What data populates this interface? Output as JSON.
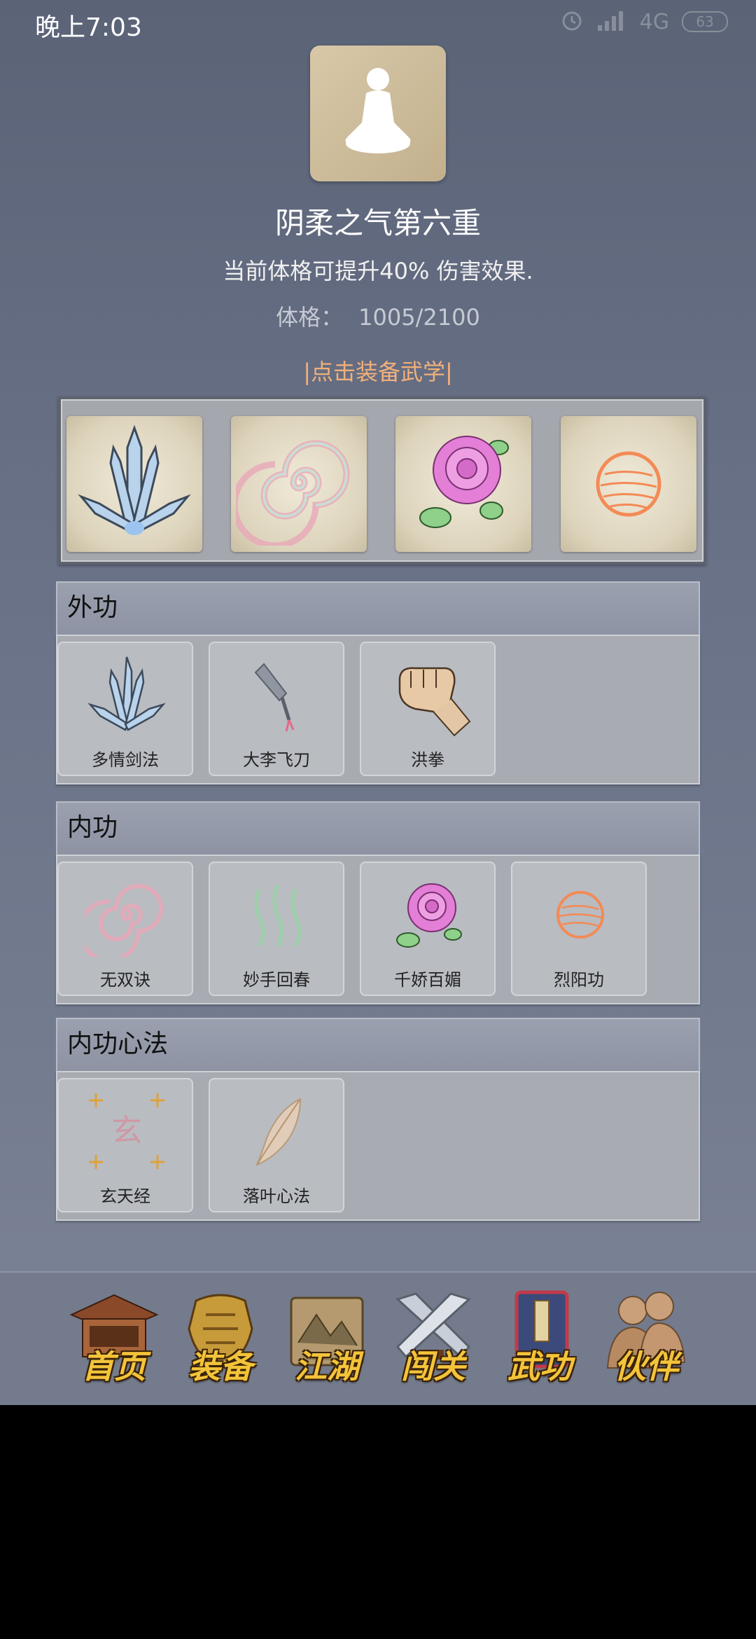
{
  "status_bar": {
    "time": "晚上7:03",
    "network": "4G",
    "battery": "63"
  },
  "header": {
    "title": "阴柔之气第六重",
    "description": "当前体格可提升40% 伤害效果.",
    "stat_label": "体格：",
    "stat_value": "1005/2100",
    "equip_hint": "|点击装备武学|"
  },
  "equipped_slots": [
    "sword-skill-icon",
    "swirl-skill-icon",
    "rose-skill-icon",
    "sun-orb-skill-icon"
  ],
  "sections": [
    {
      "title": "外功",
      "items": [
        {
          "name": "多情剑法",
          "icon": "sword-skill-icon"
        },
        {
          "name": "大李飞刀",
          "icon": "flying-knife-icon"
        },
        {
          "name": "洪拳",
          "icon": "fist-icon"
        }
      ]
    },
    {
      "title": "内功",
      "items": [
        {
          "name": "无双诀",
          "icon": "swirl-skill-icon"
        },
        {
          "name": "妙手回春",
          "icon": "healing-wave-icon"
        },
        {
          "name": "千娇百媚",
          "icon": "rose-skill-icon"
        },
        {
          "name": "烈阳功",
          "icon": "sun-orb-skill-icon"
        }
      ]
    },
    {
      "title": "内功心法",
      "items": [
        {
          "name": "玄天经",
          "icon": "xuan-scroll-icon",
          "glyph": "玄"
        },
        {
          "name": "落叶心法",
          "icon": "leaf-icon"
        }
      ]
    }
  ],
  "bottom_nav": [
    {
      "label": "首页",
      "icon": "temple-icon"
    },
    {
      "label": "装备",
      "icon": "armor-icon"
    },
    {
      "label": "江湖",
      "icon": "map-scroll-icon"
    },
    {
      "label": "闯关",
      "icon": "crossed-swords-icon"
    },
    {
      "label": "武功",
      "icon": "book-icon"
    },
    {
      "label": "伙伴",
      "icon": "partners-icon"
    }
  ]
}
